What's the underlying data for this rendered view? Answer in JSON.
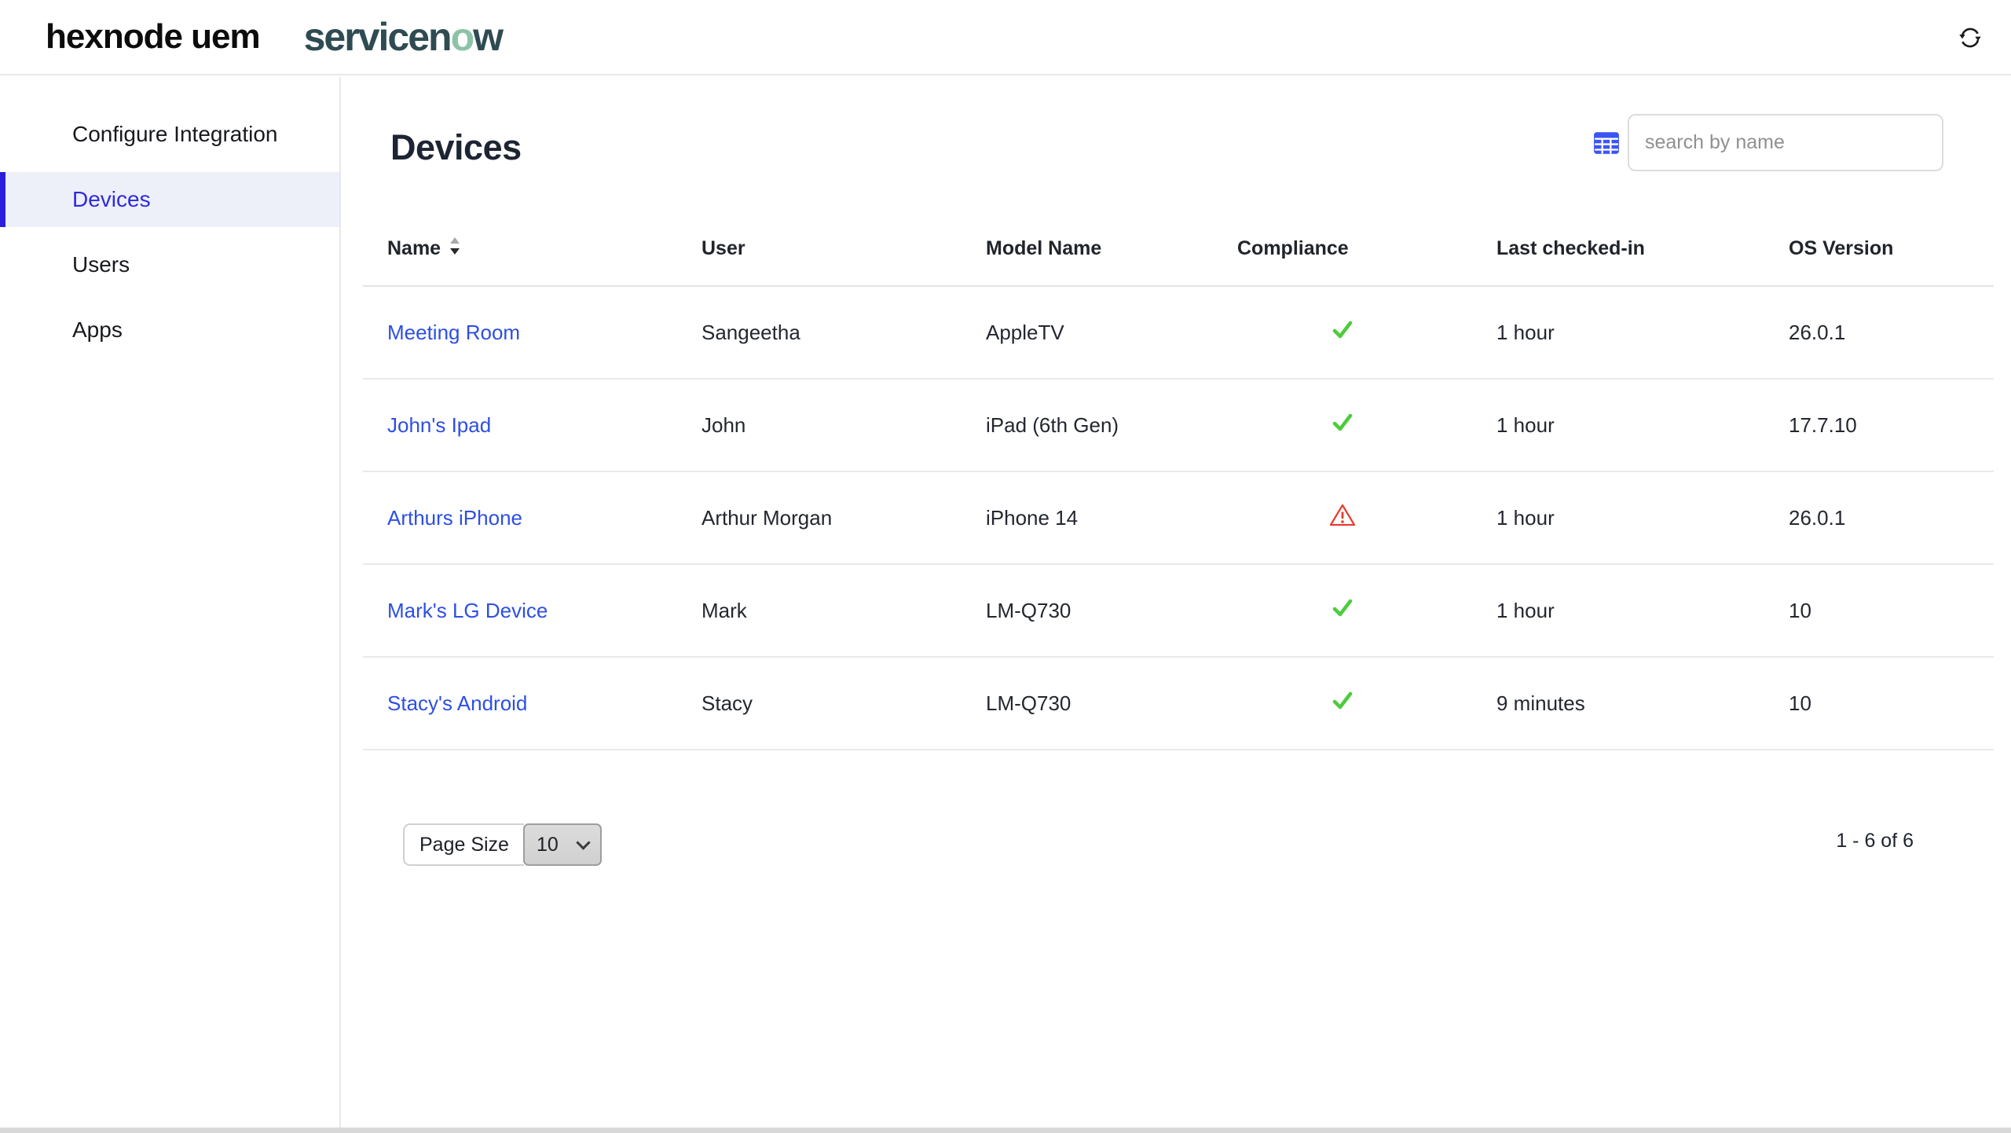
{
  "topbar": {
    "hexnode_logo": "hexnode uem",
    "servicenow_logo": {
      "part1": "servicen",
      "accent_letter": "o",
      "part2": "w"
    }
  },
  "sidebar": {
    "items": [
      {
        "label": "Configure Integration",
        "active": false
      },
      {
        "label": "Devices",
        "active": true
      },
      {
        "label": "Users",
        "active": false
      },
      {
        "label": "Apps",
        "active": false
      }
    ]
  },
  "main": {
    "title": "Devices",
    "search": {
      "placeholder": "search by name"
    }
  },
  "table": {
    "columns": [
      "Name",
      "User",
      "Model Name",
      "Compliance",
      "Last checked-in",
      "OS Version"
    ],
    "sorted_column": "Name",
    "rows": [
      {
        "name": "Meeting Room",
        "user": "Sangeetha",
        "model": "AppleTV",
        "compliance": "compliant",
        "last_checked_in": "1 hour",
        "os_version": "26.0.1"
      },
      {
        "name": "John's Ipad",
        "user": "John",
        "model": "iPad (6th Gen)",
        "compliance": "compliant",
        "last_checked_in": "1 hour",
        "os_version": "17.7.10"
      },
      {
        "name": "Arthurs iPhone",
        "user": "Arthur Morgan",
        "model": "iPhone 14",
        "compliance": "non-compliant",
        "last_checked_in": "1 hour",
        "os_version": "26.0.1"
      },
      {
        "name": "Mark's LG Device",
        "user": "Mark",
        "model": "LM-Q730",
        "compliance": "compliant",
        "last_checked_in": "1 hour",
        "os_version": "10"
      },
      {
        "name": "Stacy's Android",
        "user": "Stacy",
        "model": "LM-Q730",
        "compliance": "compliant",
        "last_checked_in": "9 minutes",
        "os_version": "10"
      }
    ]
  },
  "pagination": {
    "page_size_label": "Page Size",
    "page_size_value": "10",
    "range_text": "1 - 6 of 6"
  },
  "colors": {
    "link_blue": "#2d4fe3",
    "sidebar_active_text": "#2e2ae0",
    "sidebar_active_bar": "#2a1edb",
    "sidebar_active_bg": "#eef0f9",
    "compliant_green": "#4ecb3d",
    "non_compliant_red": "#e63c30",
    "grid_icon_blue": "#3b55f2",
    "servicenow_dark": "#2f4b52",
    "servicenow_accent": "#8cc3a8"
  }
}
